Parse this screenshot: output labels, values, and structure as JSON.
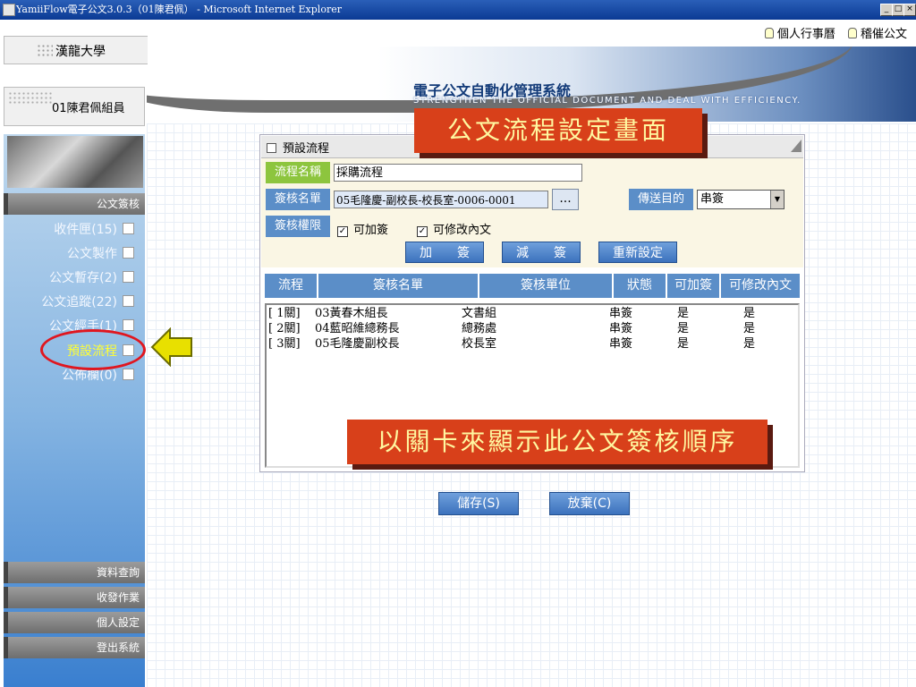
{
  "window": {
    "title": "YamiiFlow電子公文3.0.3（01陳君佩） - Microsoft Internet Explorer",
    "minimize": "_",
    "maximize": "□",
    "close": "×"
  },
  "header": {
    "school": "漢龍大學",
    "user": "01陳君佩組員",
    "links": [
      "個人行事曆",
      "稽催公文"
    ],
    "banner_title": "電子公文自動化管理系統",
    "banner_subtitle": "STRENGTHEN THE OFFICIAL DOCUMENT AND DEAL WITH EFFICIENCY."
  },
  "sidebar": {
    "section_top": "公文簽核",
    "items": [
      {
        "label": "收件匣(15)"
      },
      {
        "label": "公文製作"
      },
      {
        "label": "公文暫存(2)"
      },
      {
        "label": "公文追蹤(22)"
      },
      {
        "label": "公文經手(1)"
      },
      {
        "label": "預設流程",
        "active": true
      },
      {
        "label": "公佈欄(0)"
      }
    ],
    "bottom": [
      "資料查詢",
      "收發作業",
      "個人設定",
      "登出系統"
    ]
  },
  "panel": {
    "title": "預設流程",
    "fields": {
      "flow_name_label": "流程名稱",
      "flow_name_value": "採購流程",
      "signer_label": "簽核名單",
      "signer_value": "05毛隆慶-副校長-校長室-0006-0001",
      "browse_label": "...",
      "send_purpose_label": "傳送目的",
      "send_purpose_value": "串簽",
      "permission_label": "簽核權限",
      "can_add_label": "可加簽",
      "can_add_checked": true,
      "can_edit_label": "可修改內文",
      "can_edit_checked": true
    },
    "buttons": {
      "add": "加　　簽",
      "remove": "減　　簽",
      "reset": "重新設定"
    },
    "table": {
      "headers": [
        "流程",
        "簽核名單",
        "簽核單位",
        "狀態",
        "可加簽",
        "可修改內文"
      ],
      "rows": [
        {
          "step": "[ 1關]",
          "name": "03黃春木組長",
          "unit": "文書組",
          "status": "串簽",
          "add": "是",
          "edit": "是"
        },
        {
          "step": "[ 2關]",
          "name": "04藍昭維總務長",
          "unit": "總務處",
          "status": "串簽",
          "add": "是",
          "edit": "是"
        },
        {
          "step": "[ 3關]",
          "name": "05毛隆慶副校長",
          "unit": "校長室",
          "status": "串簽",
          "add": "是",
          "edit": "是"
        }
      ]
    }
  },
  "footer_buttons": {
    "save": "儲存(S)",
    "cancel": "放棄(C)"
  },
  "annotations": {
    "callout_top": "公文流程設定畫面",
    "callout_bottom": "以關卡來顯示此公文簽核順序"
  },
  "colors": {
    "accent_blue": "#5b8ec8",
    "label_green": "#8dc53e",
    "callout_red": "#d8401a",
    "highlight_ring": "#e0161f",
    "arrow_yellow": "#e8e000"
  }
}
